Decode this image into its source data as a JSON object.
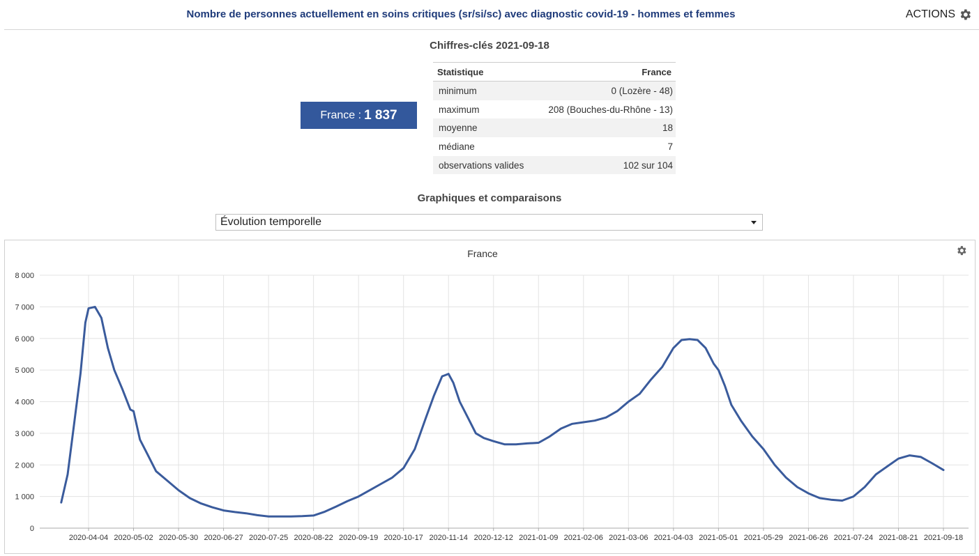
{
  "header": {
    "title": "Nombre de personnes actuellement en soins critiques (sr/si/sc) avec diagnostic covid-19 - hommes et femmes",
    "actions_label": "ACTIONS"
  },
  "key_figures": {
    "title": "Chiffres-clés 2021-09-18",
    "kpi_label": "France : ",
    "kpi_value": "1 837",
    "table": {
      "col_stat": "Statistique",
      "col_region": "France",
      "rows": [
        {
          "label": "minimum",
          "value": "0 (Lozère - 48)"
        },
        {
          "label": "maximum",
          "value": "208 (Bouches-du-Rhône - 13)"
        },
        {
          "label": "moyenne",
          "value": "18"
        },
        {
          "label": "médiane",
          "value": "7"
        },
        {
          "label": "observations valides",
          "value": "102 sur 104"
        }
      ]
    }
  },
  "comparisons": {
    "title": "Graphiques et comparaisons",
    "select_value": "Évolution temporelle"
  },
  "colors": {
    "line": "#3a5b9c",
    "accent": "#33589c",
    "title": "#1f3b7a"
  },
  "chart_data": {
    "type": "line",
    "title": "France",
    "xlabel": "",
    "ylabel": "",
    "ylim": [
      0,
      8000
    ],
    "yticks": [
      0,
      1000,
      2000,
      3000,
      4000,
      5000,
      6000,
      7000,
      8000
    ],
    "ytick_labels": [
      "0",
      "1 000",
      "2 000",
      "3 000",
      "4 000",
      "5 000",
      "6 000",
      "7 000",
      "8 000"
    ],
    "xticks": [
      "2020-04-04",
      "2020-05-02",
      "2020-05-30",
      "2020-06-27",
      "2020-07-25",
      "2020-08-22",
      "2020-09-19",
      "2020-10-17",
      "2020-11-14",
      "2020-12-12",
      "2021-01-09",
      "2021-02-06",
      "2021-03-06",
      "2021-04-03",
      "2021-05-01",
      "2021-05-29",
      "2021-06-26",
      "2021-07-24",
      "2021-08-21",
      "2021-09-18"
    ],
    "grid": true,
    "legend": "none",
    "series": [
      {
        "x": [
          "2020-03-18",
          "2020-03-22",
          "2020-03-26",
          "2020-03-30",
          "2020-04-02",
          "2020-04-04",
          "2020-04-08",
          "2020-04-12",
          "2020-04-16",
          "2020-04-20",
          "2020-04-25",
          "2020-04-30",
          "2020-05-02",
          "2020-05-06",
          "2020-05-11",
          "2020-05-16",
          "2020-05-23",
          "2020-05-30",
          "2020-06-06",
          "2020-06-13",
          "2020-06-20",
          "2020-06-27",
          "2020-07-04",
          "2020-07-11",
          "2020-07-18",
          "2020-07-25",
          "2020-08-01",
          "2020-08-08",
          "2020-08-15",
          "2020-08-22",
          "2020-08-29",
          "2020-09-05",
          "2020-09-12",
          "2020-09-19",
          "2020-09-26",
          "2020-10-03",
          "2020-10-10",
          "2020-10-17",
          "2020-10-24",
          "2020-10-31",
          "2020-11-05",
          "2020-11-10",
          "2020-11-14",
          "2020-11-17",
          "2020-11-21",
          "2020-11-26",
          "2020-12-01",
          "2020-12-06",
          "2020-12-12",
          "2020-12-19",
          "2020-12-26",
          "2021-01-02",
          "2021-01-09",
          "2021-01-16",
          "2021-01-23",
          "2021-01-30",
          "2021-02-06",
          "2021-02-13",
          "2021-02-20",
          "2021-02-27",
          "2021-03-06",
          "2021-03-13",
          "2021-03-20",
          "2021-03-27",
          "2021-04-03",
          "2021-04-08",
          "2021-04-13",
          "2021-04-18",
          "2021-04-23",
          "2021-04-28",
          "2021-05-01",
          "2021-05-05",
          "2021-05-09",
          "2021-05-15",
          "2021-05-22",
          "2021-05-29",
          "2021-06-05",
          "2021-06-12",
          "2021-06-19",
          "2021-06-26",
          "2021-07-03",
          "2021-07-10",
          "2021-07-17",
          "2021-07-24",
          "2021-07-31",
          "2021-08-07",
          "2021-08-14",
          "2021-08-21",
          "2021-08-28",
          "2021-09-04",
          "2021-09-11",
          "2021-09-18"
        ],
        "y": [
          810,
          1700,
          3300,
          4900,
          6500,
          6950,
          7000,
          6650,
          5700,
          5000,
          4400,
          3750,
          3700,
          2800,
          2300,
          1800,
          1500,
          1200,
          950,
          780,
          660,
          560,
          510,
          470,
          410,
          370,
          370,
          370,
          380,
          400,
          520,
          680,
          850,
          1000,
          1200,
          1400,
          1600,
          1900,
          2500,
          3500,
          4200,
          4800,
          4880,
          4600,
          4000,
          3500,
          3000,
          2850,
          2750,
          2650,
          2650,
          2680,
          2700,
          2900,
          3150,
          3300,
          3350,
          3400,
          3500,
          3700,
          4000,
          4250,
          4700,
          5100,
          5700,
          5950,
          5980,
          5950,
          5700,
          5200,
          5000,
          4500,
          3900,
          3400,
          2900,
          2500,
          2000,
          1600,
          1300,
          1100,
          950,
          900,
          870,
          1000,
          1300,
          1700,
          1950,
          2200,
          2300,
          2250,
          2050,
          1837
        ]
      }
    ]
  }
}
